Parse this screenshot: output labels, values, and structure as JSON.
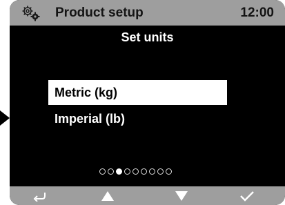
{
  "header": {
    "title": "Product setup",
    "time": "12:00",
    "settings_icon": "gears-icon"
  },
  "screen": {
    "heading": "Set units",
    "options": [
      {
        "label": "Metric (kg)",
        "selected": true
      },
      {
        "label": "Imperial (lb)",
        "selected": false
      }
    ],
    "page_indicator": {
      "count": 9,
      "active": 3
    }
  },
  "softkeys": [
    {
      "icon": "back-arrow-icon"
    },
    {
      "icon": "up-arrow-icon"
    },
    {
      "icon": "down-arrow-icon"
    },
    {
      "icon": "checkmark-icon"
    }
  ],
  "colors": {
    "bar": "#9e9e9e",
    "screen": "#000000",
    "highlight": "#ffffff"
  }
}
